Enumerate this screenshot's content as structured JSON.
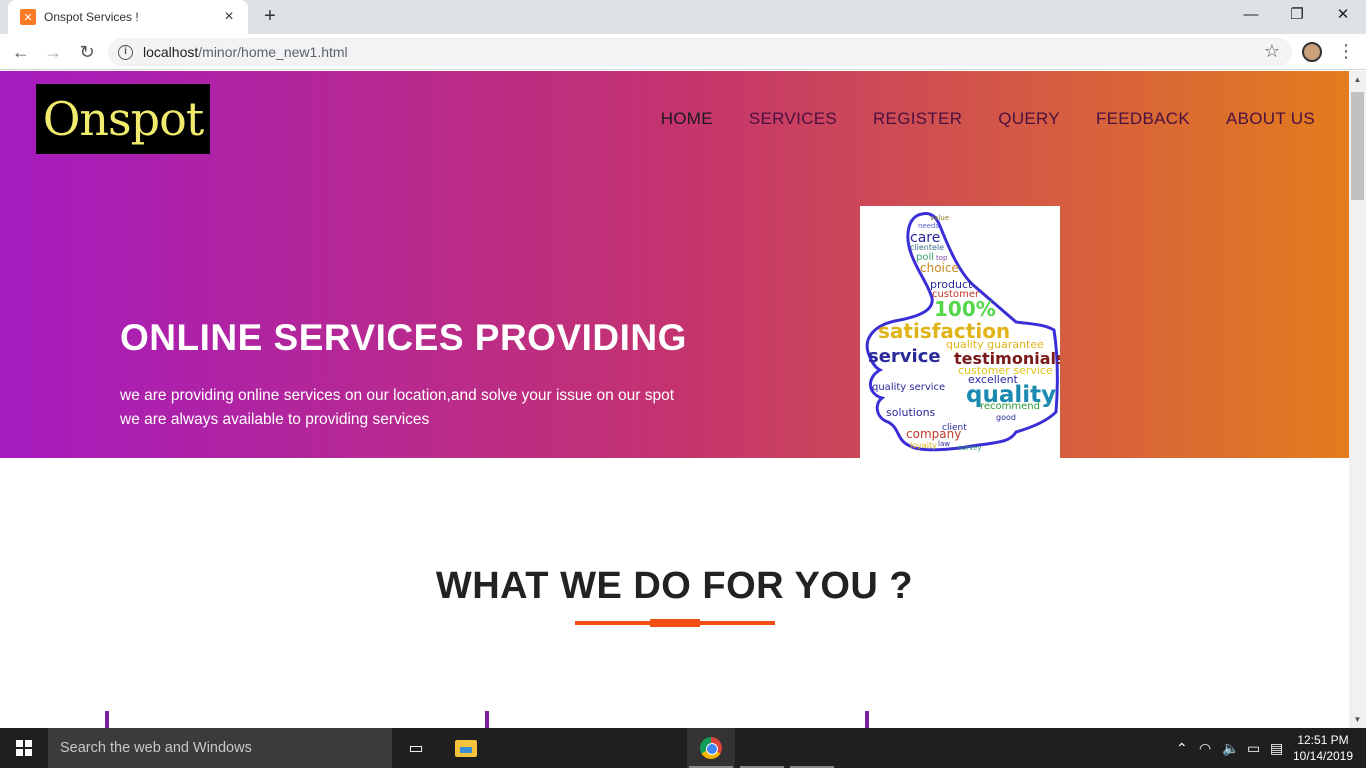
{
  "browser": {
    "tab_title": "Onspot Services !",
    "url_host": "localhost",
    "url_path": "/minor/home_new1.html"
  },
  "site": {
    "logo_text": "Onspot",
    "nav": [
      "HOME",
      "SERVICES",
      "REGISTER",
      "QUERY",
      "FEEDBACK",
      "ABOUT US"
    ],
    "hero_title": "ONLINE SERVICES PROVIDING",
    "hero_text": "we are providing online services on our location,and solve your issue on our spot we are always available to providing services",
    "section_title": "WHAT WE DO FOR YOU ?",
    "hero_image_words": [
      "value",
      "needs",
      "care",
      "clientele",
      "poll",
      "top",
      "choice",
      "product",
      "customer",
      "100%",
      "satisfaction",
      "quality guarantee",
      "service",
      "testimonials",
      "customer service",
      "excellent",
      "quality service",
      "quality",
      "recommend",
      "solutions",
      "client",
      "company",
      "good",
      "loyalty",
      "law",
      "survey"
    ]
  },
  "taskbar": {
    "search_placeholder": "Search the web and Windows",
    "time": "12:51 PM",
    "date": "10/14/2019"
  },
  "colors": {
    "hero_start": "#a51bbf",
    "hero_mid": "#c4336f",
    "hero_end": "#e37d1d",
    "accent": "#f04e12",
    "logo_text": "#f0ea6d"
  }
}
